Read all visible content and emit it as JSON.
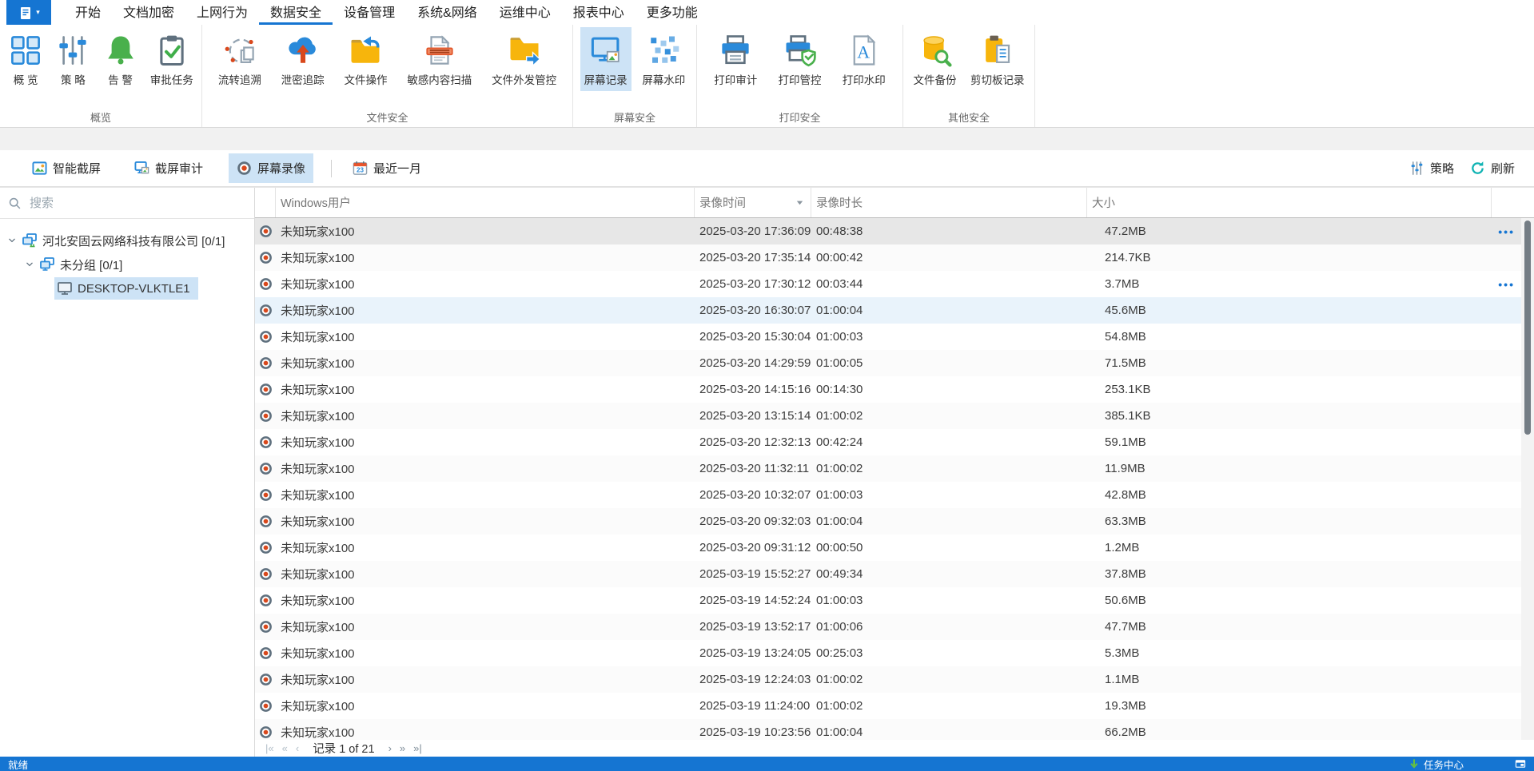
{
  "menu": {
    "active_tab": "数据安全",
    "tabs": [
      "开始",
      "文档加密",
      "上网行为",
      "数据安全",
      "设备管理",
      "系统&网络",
      "运维中心",
      "报表中心",
      "更多功能"
    ]
  },
  "ribbon": {
    "groups": [
      {
        "label": "概览",
        "items": [
          {
            "label": "概 览",
            "icon": "overview"
          },
          {
            "label": "策 略",
            "icon": "policy"
          },
          {
            "label": "告 警",
            "icon": "alert"
          },
          {
            "label": "审批任务",
            "icon": "approval"
          }
        ]
      },
      {
        "label": "文件安全",
        "items": [
          {
            "label": "流转追溯",
            "icon": "trace"
          },
          {
            "label": "泄密追踪",
            "icon": "leak"
          },
          {
            "label": "文件操作",
            "icon": "file-op"
          },
          {
            "label": "敏感内容扫描",
            "icon": "content-scan"
          },
          {
            "label": "文件外发管控",
            "icon": "file-out"
          }
        ]
      },
      {
        "label": "屏幕安全",
        "items": [
          {
            "label": "屏幕记录",
            "icon": "screen-record",
            "selected": true
          },
          {
            "label": "屏幕水印",
            "icon": "screen-watermark"
          }
        ]
      },
      {
        "label": "打印安全",
        "items": [
          {
            "label": "打印审计",
            "icon": "print-audit"
          },
          {
            "label": "打印管控",
            "icon": "print-control"
          },
          {
            "label": "打印水印",
            "icon": "print-watermark"
          }
        ]
      },
      {
        "label": "其他安全",
        "items": [
          {
            "label": "文件备份",
            "icon": "file-backup"
          },
          {
            "label": "剪切板记录",
            "icon": "clipboard-record"
          }
        ]
      }
    ]
  },
  "toolbar": {
    "left": [
      {
        "label": "智能截屏",
        "icon": "smart-capture"
      },
      {
        "label": "截屏审计",
        "icon": "capture-audit"
      },
      {
        "label": "屏幕录像",
        "icon": "record",
        "selected": true
      },
      {
        "label": "最近一月",
        "icon": "calendar-23",
        "separator_before": true
      }
    ],
    "right": [
      {
        "label": "策略",
        "icon": "policy-small"
      },
      {
        "label": "刷新",
        "icon": "refresh"
      }
    ]
  },
  "sidebar": {
    "search_placeholder": "搜索",
    "tree": [
      {
        "label": "河北安固云网络科技有限公司 [0/1]",
        "icon": "org",
        "level": 0,
        "expanded": true
      },
      {
        "label": "未分组 [0/1]",
        "icon": "group",
        "level": 1,
        "expanded": true
      },
      {
        "label": "DESKTOP-VLKTLE1",
        "icon": "computer",
        "level": 2,
        "selected": true
      }
    ]
  },
  "table": {
    "columns": [
      "Windows用户",
      "录像时间",
      "录像时长",
      "大小"
    ],
    "sort_column": "录像时间",
    "rows": [
      {
        "user": "未知玩家x100",
        "time": "2025-03-20 17:36:09",
        "duration": "00:48:38",
        "size": "47.2MB",
        "state": "focused",
        "actions": true
      },
      {
        "user": "未知玩家x100",
        "time": "2025-03-20 17:35:14",
        "duration": "00:00:42",
        "size": "214.7KB",
        "state": "",
        "actions": false
      },
      {
        "user": "未知玩家x100",
        "time": "2025-03-20 17:30:12",
        "duration": "00:03:44",
        "size": "3.7MB",
        "state": "",
        "actions": true
      },
      {
        "user": "未知玩家x100",
        "time": "2025-03-20 16:30:07",
        "duration": "01:00:04",
        "size": "45.6MB",
        "state": "highlight",
        "actions": false
      },
      {
        "user": "未知玩家x100",
        "time": "2025-03-20 15:30:04",
        "duration": "01:00:03",
        "size": "54.8MB",
        "state": "",
        "actions": false
      },
      {
        "user": "未知玩家x100",
        "time": "2025-03-20 14:29:59",
        "duration": "01:00:05",
        "size": "71.5MB",
        "state": "",
        "actions": false
      },
      {
        "user": "未知玩家x100",
        "time": "2025-03-20 14:15:16",
        "duration": "00:14:30",
        "size": "253.1KB",
        "state": "",
        "actions": false
      },
      {
        "user": "未知玩家x100",
        "time": "2025-03-20 13:15:14",
        "duration": "01:00:02",
        "size": "385.1KB",
        "state": "",
        "actions": false
      },
      {
        "user": "未知玩家x100",
        "time": "2025-03-20 12:32:13",
        "duration": "00:42:24",
        "size": "59.1MB",
        "state": "",
        "actions": false
      },
      {
        "user": "未知玩家x100",
        "time": "2025-03-20 11:32:11",
        "duration": "01:00:02",
        "size": "11.9MB",
        "state": "",
        "actions": false
      },
      {
        "user": "未知玩家x100",
        "time": "2025-03-20 10:32:07",
        "duration": "01:00:03",
        "size": "42.8MB",
        "state": "",
        "actions": false
      },
      {
        "user": "未知玩家x100",
        "time": "2025-03-20 09:32:03",
        "duration": "01:00:04",
        "size": "63.3MB",
        "state": "",
        "actions": false
      },
      {
        "user": "未知玩家x100",
        "time": "2025-03-20 09:31:12",
        "duration": "00:00:50",
        "size": "1.2MB",
        "state": "",
        "actions": false
      },
      {
        "user": "未知玩家x100",
        "time": "2025-03-19 15:52:27",
        "duration": "00:49:34",
        "size": "37.8MB",
        "state": "",
        "actions": false
      },
      {
        "user": "未知玩家x100",
        "time": "2025-03-19 14:52:24",
        "duration": "01:00:03",
        "size": "50.6MB",
        "state": "",
        "actions": false
      },
      {
        "user": "未知玩家x100",
        "time": "2025-03-19 13:52:17",
        "duration": "01:00:06",
        "size": "47.7MB",
        "state": "",
        "actions": false
      },
      {
        "user": "未知玩家x100",
        "time": "2025-03-19 13:24:05",
        "duration": "00:25:03",
        "size": "5.3MB",
        "state": "",
        "actions": false
      },
      {
        "user": "未知玩家x100",
        "time": "2025-03-19 12:24:03",
        "duration": "01:00:02",
        "size": "1.1MB",
        "state": "",
        "actions": false
      },
      {
        "user": "未知玩家x100",
        "time": "2025-03-19 11:24:00",
        "duration": "01:00:02",
        "size": "19.3MB",
        "state": "",
        "actions": false
      },
      {
        "user": "未知玩家x100",
        "time": "2025-03-19 10:23:56",
        "duration": "01:00:04",
        "size": "66.2MB",
        "state": "",
        "actions": false
      }
    ]
  },
  "pagination": {
    "label": "记录 1 of 21"
  },
  "statusbar": {
    "ready": "就绪",
    "task_center": "任务中心"
  },
  "colors": {
    "accent": "#1575d2",
    "selection": "#cde3f6",
    "record_red": "#d9481c",
    "status_green": "#66b13f",
    "refresh_teal": "#0fb3b3",
    "folder_yellow": "#f7b50c"
  }
}
